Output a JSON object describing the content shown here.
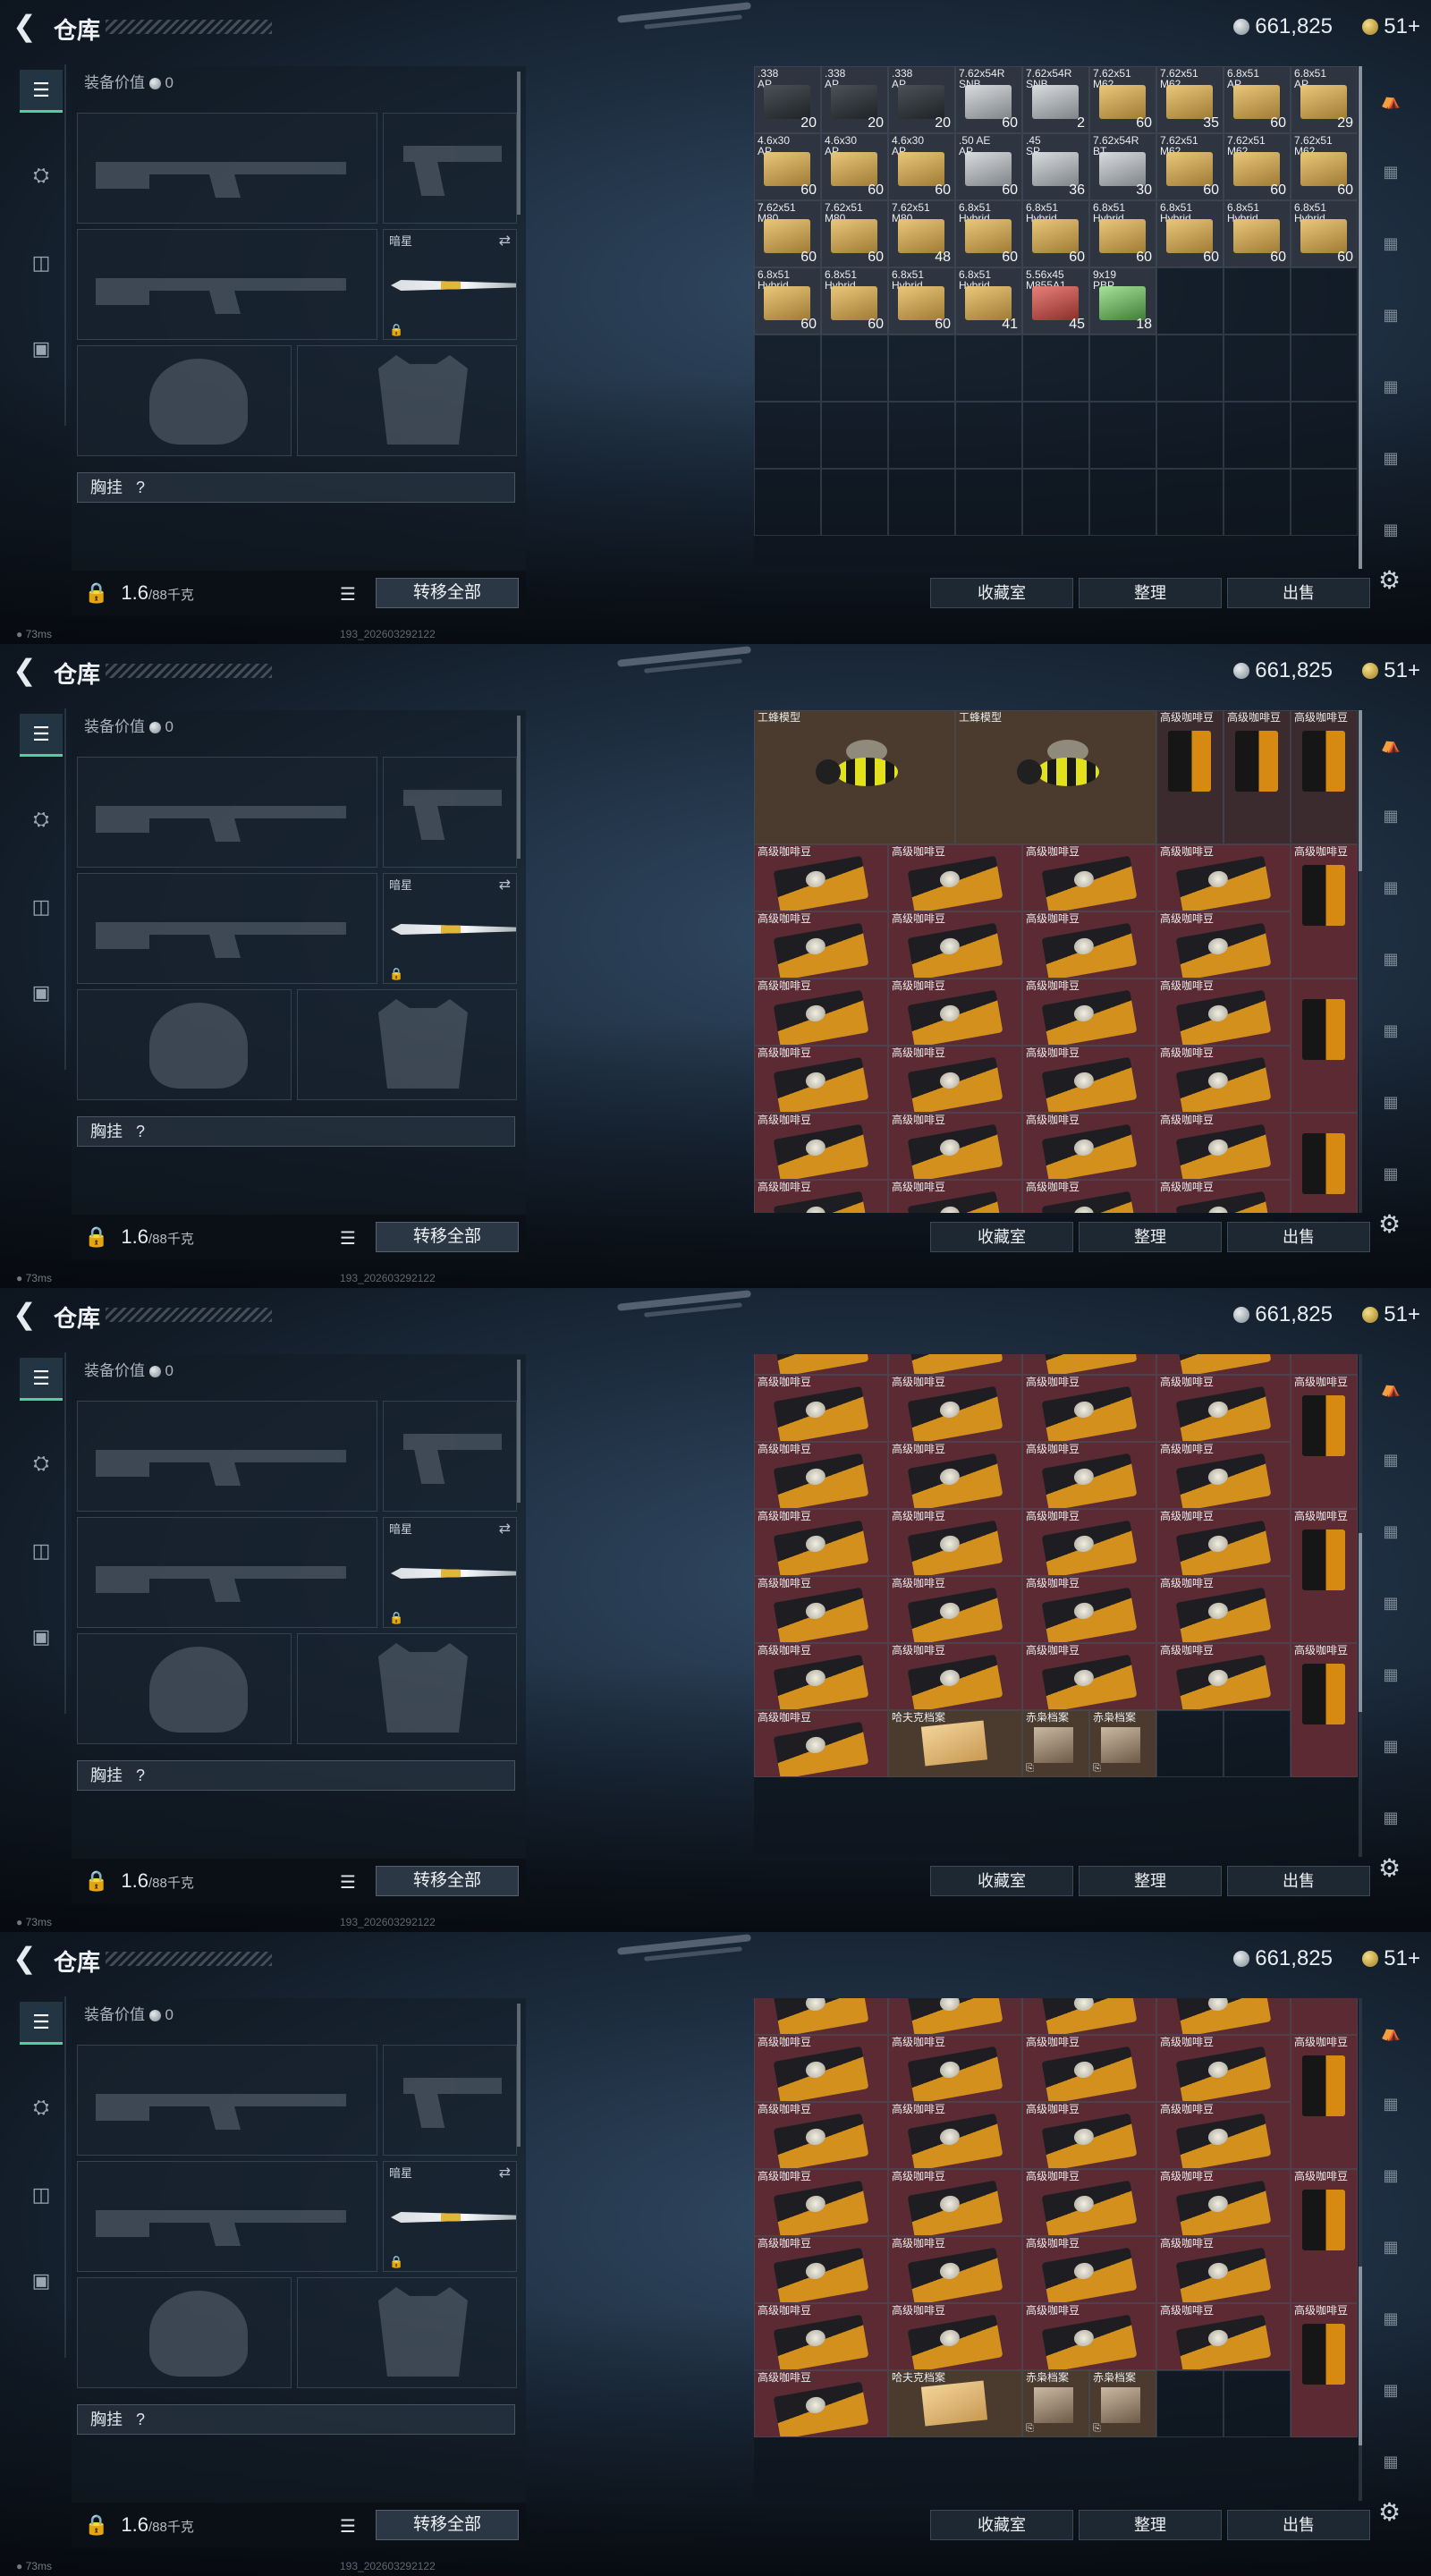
{
  "header": {
    "title": "仓库",
    "silver": "661,825",
    "gold": "51+"
  },
  "equipment": {
    "value_label": "装备价值",
    "value": "0",
    "knife_name": "暗星",
    "chest_label": "胸挂",
    "chest_hint": "?",
    "weight": "1.6",
    "weight_max": "/88千克",
    "transfer_all": "转移全部"
  },
  "buttons": {
    "collection": "收藏室",
    "sort": "整理",
    "sell": "出售"
  },
  "status": {
    "ping": "73ms",
    "build": "193_202603292122"
  },
  "panels": [
    {
      "cells": [
        {
          "name": ".338\nAP",
          "qty": "20",
          "kind": "ammo",
          "box": "dark"
        },
        {
          "name": ".338\nAP",
          "qty": "20",
          "kind": "ammo",
          "box": "dark"
        },
        {
          "name": ".338\nAP",
          "qty": "20",
          "kind": "ammo",
          "box": "dark"
        },
        {
          "name": "7.62x54R\nSNB",
          "qty": "60",
          "kind": "ammo",
          "box": "grey"
        },
        {
          "name": "7.62x54R\nSNB",
          "qty": "2",
          "kind": "ammo",
          "box": "grey"
        },
        {
          "name": "7.62x51\nM62",
          "qty": "60",
          "kind": "ammo",
          "box": "tan"
        },
        {
          "name": "7.62x51\nM62",
          "qty": "35",
          "kind": "ammo",
          "box": "tan"
        },
        {
          "name": "6.8x51\nAP",
          "qty": "60",
          "kind": "ammo",
          "box": "tan"
        },
        {
          "name": "6.8x51\nAP",
          "qty": "29",
          "kind": "ammo",
          "box": "tan"
        },
        {
          "name": "4.6x30\nAP",
          "qty": "60",
          "kind": "ammo",
          "box": "tan"
        },
        {
          "name": "4.6x30\nAP",
          "qty": "60",
          "kind": "ammo",
          "box": "tan"
        },
        {
          "name": "4.6x30\nAP",
          "qty": "60",
          "kind": "ammo",
          "box": "tan"
        },
        {
          "name": ".50 AE\nAP",
          "qty": "60",
          "kind": "ammo",
          "box": "grey"
        },
        {
          "name": ".45\nSP",
          "qty": "36",
          "kind": "ammo",
          "box": "grey"
        },
        {
          "name": "7.62x54R\nBT",
          "qty": "30",
          "kind": "ammo",
          "box": "grey"
        },
        {
          "name": "7.62x51\nM62",
          "qty": "60",
          "kind": "ammo",
          "box": "tan"
        },
        {
          "name": "7.62x51\nM62",
          "qty": "60",
          "kind": "ammo",
          "box": "tan"
        },
        {
          "name": "7.62x51\nM62",
          "qty": "60",
          "kind": "ammo",
          "box": "tan"
        },
        {
          "name": "7.62x51\nM80",
          "qty": "60",
          "kind": "ammo",
          "box": "tan"
        },
        {
          "name": "7.62x51\nM80",
          "qty": "60",
          "kind": "ammo",
          "box": "tan"
        },
        {
          "name": "7.62x51\nM80",
          "qty": "48",
          "kind": "ammo",
          "box": "tan"
        },
        {
          "name": "6.8x51\nHybrid",
          "qty": "60",
          "kind": "ammo",
          "box": "tan"
        },
        {
          "name": "6.8x51\nHybrid",
          "qty": "60",
          "kind": "ammo",
          "box": "tan"
        },
        {
          "name": "6.8x51\nHybrid",
          "qty": "60",
          "kind": "ammo",
          "box": "tan"
        },
        {
          "name": "6.8x51\nHybrid",
          "qty": "60",
          "kind": "ammo",
          "box": "tan"
        },
        {
          "name": "6.8x51\nHybrid",
          "qty": "60",
          "kind": "ammo",
          "box": "tan"
        },
        {
          "name": "6.8x51\nHybrid",
          "qty": "60",
          "kind": "ammo",
          "box": "tan"
        },
        {
          "name": "6.8x51\nHybrid",
          "qty": "60",
          "kind": "ammo",
          "box": "tan"
        },
        {
          "name": "6.8x51\nHybrid",
          "qty": "60",
          "kind": "ammo",
          "box": "tan"
        },
        {
          "name": "6.8x51\nHybrid",
          "qty": "60",
          "kind": "ammo",
          "box": "tan"
        },
        {
          "name": "6.8x51\nHybrid",
          "qty": "41",
          "kind": "ammo",
          "box": "tan"
        },
        {
          "name": "5.56x45\nM855A1",
          "qty": "45",
          "kind": "ammo",
          "box": "red"
        },
        {
          "name": "9x19\nPBP",
          "qty": "18",
          "kind": "ammo",
          "box": "green"
        }
      ]
    },
    {
      "items": {
        "bee": "工蜂模型",
        "coffee": "高级咖啡豆"
      }
    },
    {
      "items": {
        "coffee": "高级咖啡豆",
        "paper": "哈夫克档案",
        "photo": "赤枭档案"
      }
    },
    {
      "items": {
        "coffee": "高级咖啡豆",
        "paper": "哈夫克档案",
        "photo": "赤枭档案"
      }
    }
  ]
}
